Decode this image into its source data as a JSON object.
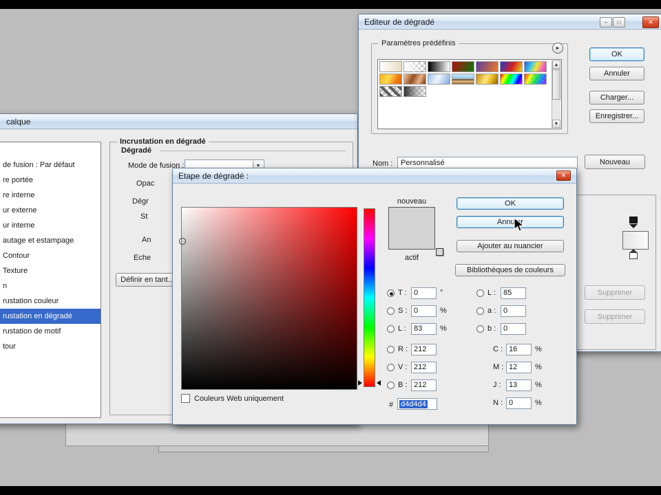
{
  "desktop": {
    "bg": "#bdbdbd",
    "letterbox_color": "#000000"
  },
  "layer_style": {
    "title": "calque",
    "list_items": [
      "de fusion : Par défaut",
      "re portée",
      "re interne",
      "ur externe",
      "ur interne",
      "autage et estampage",
      "Contour",
      "Texture",
      "n",
      "rustation couleur",
      "rustation en dégradé",
      "rustation de motif",
      "tour"
    ],
    "selected_item": "rustation en dégradé",
    "group_title": "Incrustation en dégradé",
    "section_title": "Dégradé",
    "blend_mode_label": "Mode de fusion :",
    "row_fragments": [
      "Opac",
      "Dégr",
      "St",
      "An",
      "Eche"
    ],
    "define_button": "Définir en tant..."
  },
  "gradient_editor": {
    "title": "Editeur de dégradé",
    "minimize_glyph": "–",
    "maximize_glyph": "□",
    "close_glyph": "✕",
    "presets_title": "Paramètres prédéfinis",
    "menu_arrow_glyph": "►",
    "scroll_up_glyph": "▲",
    "scroll_down_glyph": "▼",
    "ok_button": "OK",
    "cancel_button": "Annuler",
    "load_button": "Charger...",
    "save_button": "Enregistrer...",
    "name_label": "Nom :",
    "name_value": "Personnalisé",
    "new_button": "Nouveau",
    "delete_button_1": "Supprimer",
    "delete_button_2": "Supprimer",
    "swatch_styles": [
      "background:linear-gradient(100deg,#ffffff,#eadcc0);",
      "background-color:#fff;background-image:linear-gradient(90deg,#ffffff,rgba(255,255,255,0)),linear-gradient(45deg,#c0c0c0 25%,transparent 25%,transparent 75%,#c0c0c0 75%),linear-gradient(45deg,#c0c0c0 25%,transparent 25%,transparent 75%,#c0c0c0 75%);background-size:auto,8px 8px,8px 8px;background-position:0 0,0 0,4px 4px;",
      "background:linear-gradient(90deg,#000000,#ffffff);",
      "background:linear-gradient(115deg,#b01010,#12750f);",
      "background:linear-gradient(115deg,#5b3a9e,#ef7d23);",
      "background:linear-gradient(115deg,#2238c8,#d42222 55%,#ead61f);",
      "background:linear-gradient(115deg,#2f58d8 0%,#3fc4ea 30%,#efe73a 55%,#ef6ab8 80%,#d83fae 100%);",
      "background:linear-gradient(115deg,#f2b21d,#ffd94e 40%,#ef7d12 75%,#d8660a);",
      "background:linear-gradient(115deg,#f6ccaa 0%,#93501f 40%,#eab085 70%,#713a12 100%);",
      "background:linear-gradient(115deg,#9cc0ee,#eef6ff 45%,#86a8dd);",
      "background:linear-gradient(180deg,#cde9f8 0%,#92c5e4 46%,#6e4a1e 54%,#e7c28c 75%,#8d5a28 100%);",
      "background:linear-gradient(115deg,#c3830f,#ffe878 45%,#eebd2a 65%,#8d5f07);",
      "background:linear-gradient(115deg,#ff0000,#ffff00 20%,#00ff00 40%,#00ffff 60%,#0000ff 80%,#ff00ff 100%);",
      "background-color:#fff;background-image:linear-gradient(115deg,rgba(255,0,0,.85),rgba(255,255,0,.85) 25%,rgba(0,230,60,.85) 50%,rgba(0,120,255,.85) 75%,rgba(170,0,255,.85)),linear-gradient(45deg,#c0c0c0 25%,transparent 25%,transparent 75%,#c0c0c0 75%),linear-gradient(45deg,#c0c0c0 25%,transparent 25%,transparent 75%,#c0c0c0 75%);background-size:auto,8px 8px,8px 8px;background-position:0 0,0 0,4px 4px;",
      "background-color:#fff;background-image:repeating-linear-gradient(45deg,rgba(70,70,70,.85) 0 4px,rgba(0,0,0,0) 4px 9px),linear-gradient(45deg,#c0c0c0 25%,transparent 25%,transparent 75%,#c0c0c0 75%),linear-gradient(45deg,#c0c0c0 25%,transparent 25%,transparent 75%,#c0c0c0 75%);background-size:auto,8px 8px,8px 8px;background-position:0 0,0 0,4px 4px;",
      "background-color:#fff;background-image:linear-gradient(90deg,rgba(40,40,40,.95),rgba(150,150,150,.55) 60%,rgba(230,230,230,.25)),linear-gradient(45deg,#c0c0c0 25%,transparent 25%,transparent 75%,#c0c0c0 75%),linear-gradient(45deg,#c0c0c0 25%,transparent 25%,transparent 75%,#c0c0c0 75%);background-size:auto,8px 8px,8px 8px;background-position:0 0,0 0,4px 4px;"
    ]
  },
  "color_picker": {
    "title": "Etape de dégradé :",
    "close_glyph": "✕",
    "new_label": "nouveau",
    "current_label": "actif",
    "new_color": "#d4d4d4",
    "current_color": "#d4d4d4",
    "ok_button": "OK",
    "cancel_button": "Annuler",
    "add_to_swatches_button": "Ajouter au nuancier",
    "color_libraries_button": "Bibliothèques de couleurs",
    "hsb_fields": [
      {
        "label": "T :",
        "value": "0",
        "suffix": "°",
        "radio": true,
        "checked": true
      },
      {
        "label": "S :",
        "value": "0",
        "suffix": "%",
        "radio": true,
        "checked": false
      },
      {
        "label": "L :",
        "value": "83",
        "suffix": "%",
        "radio": true,
        "checked": false
      }
    ],
    "rgb_fields": [
      {
        "label": "R :",
        "value": "212",
        "suffix": "",
        "radio": true,
        "checked": false
      },
      {
        "label": "V :",
        "value": "212",
        "suffix": "",
        "radio": true,
        "checked": false
      },
      {
        "label": "B :",
        "value": "212",
        "suffix": "",
        "radio": true,
        "checked": false
      }
    ],
    "lab_fields": [
      {
        "label": "L :",
        "value": "85",
        "suffix": "",
        "radio": true,
        "checked": false
      },
      {
        "label": "a :",
        "value": "0",
        "suffix": "",
        "radio": true,
        "checked": false
      },
      {
        "label": "b :",
        "value": "0",
        "suffix": "",
        "radio": true,
        "checked": false
      }
    ],
    "cmjn_fields": [
      {
        "label": "C :",
        "value": "16",
        "suffix": "%"
      },
      {
        "label": "M :",
        "value": "12",
        "suffix": "%"
      },
      {
        "label": "J :",
        "value": "13",
        "suffix": "%"
      },
      {
        "label": "N :",
        "value": "0",
        "suffix": "%"
      }
    ],
    "hex_label": "#",
    "hex_value": "d4d4d4",
    "web_only_label": "Couleurs Web uniquement"
  }
}
